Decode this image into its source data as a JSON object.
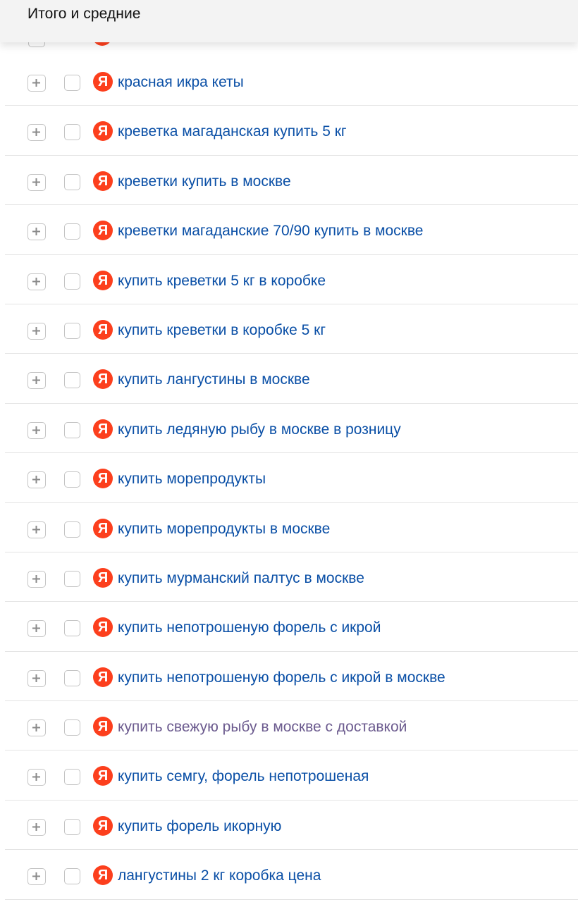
{
  "header": {
    "title": "Итого и средние"
  },
  "colors": {
    "link": "#0a4fa6",
    "visited_link": "#6b5a8e",
    "yandex_logo": "#fc3f1d",
    "header_bg": "#f3f3f3"
  },
  "icons": {
    "expand": "plus-icon",
    "source": "yandex-logo-icon"
  },
  "logo_letter": "Я",
  "rows": [
    {
      "keyword": "красная икра кеты",
      "visited": false
    },
    {
      "keyword": "креветка магаданская купить 5 кг",
      "visited": false
    },
    {
      "keyword": "креветки купить в москве",
      "visited": false
    },
    {
      "keyword": "креветки магаданские 70/90 купить в москве",
      "visited": false
    },
    {
      "keyword": "купить креветки 5 кг в коробке",
      "visited": false
    },
    {
      "keyword": "купить креветки в коробке 5 кг",
      "visited": false
    },
    {
      "keyword": "купить лангустины в москве",
      "visited": false
    },
    {
      "keyword": "купить ледяную рыбу в москве в розницу",
      "visited": false
    },
    {
      "keyword": "купить морепродукты",
      "visited": false
    },
    {
      "keyword": "купить морепродукты в москве",
      "visited": false
    },
    {
      "keyword": "купить мурманский палтус в москве",
      "visited": false
    },
    {
      "keyword": "купить непотрошеную форель с икрой",
      "visited": false
    },
    {
      "keyword": "купить непотрошеную форель с икрой в москве",
      "visited": false
    },
    {
      "keyword": "купить свежую рыбу в москве с доставкой",
      "visited": true
    },
    {
      "keyword": "купить семгу, форель непотрошеная",
      "visited": false
    },
    {
      "keyword": "купить форель икорную",
      "visited": false
    },
    {
      "keyword": "лангустины 2 кг коробка цена",
      "visited": false
    }
  ]
}
